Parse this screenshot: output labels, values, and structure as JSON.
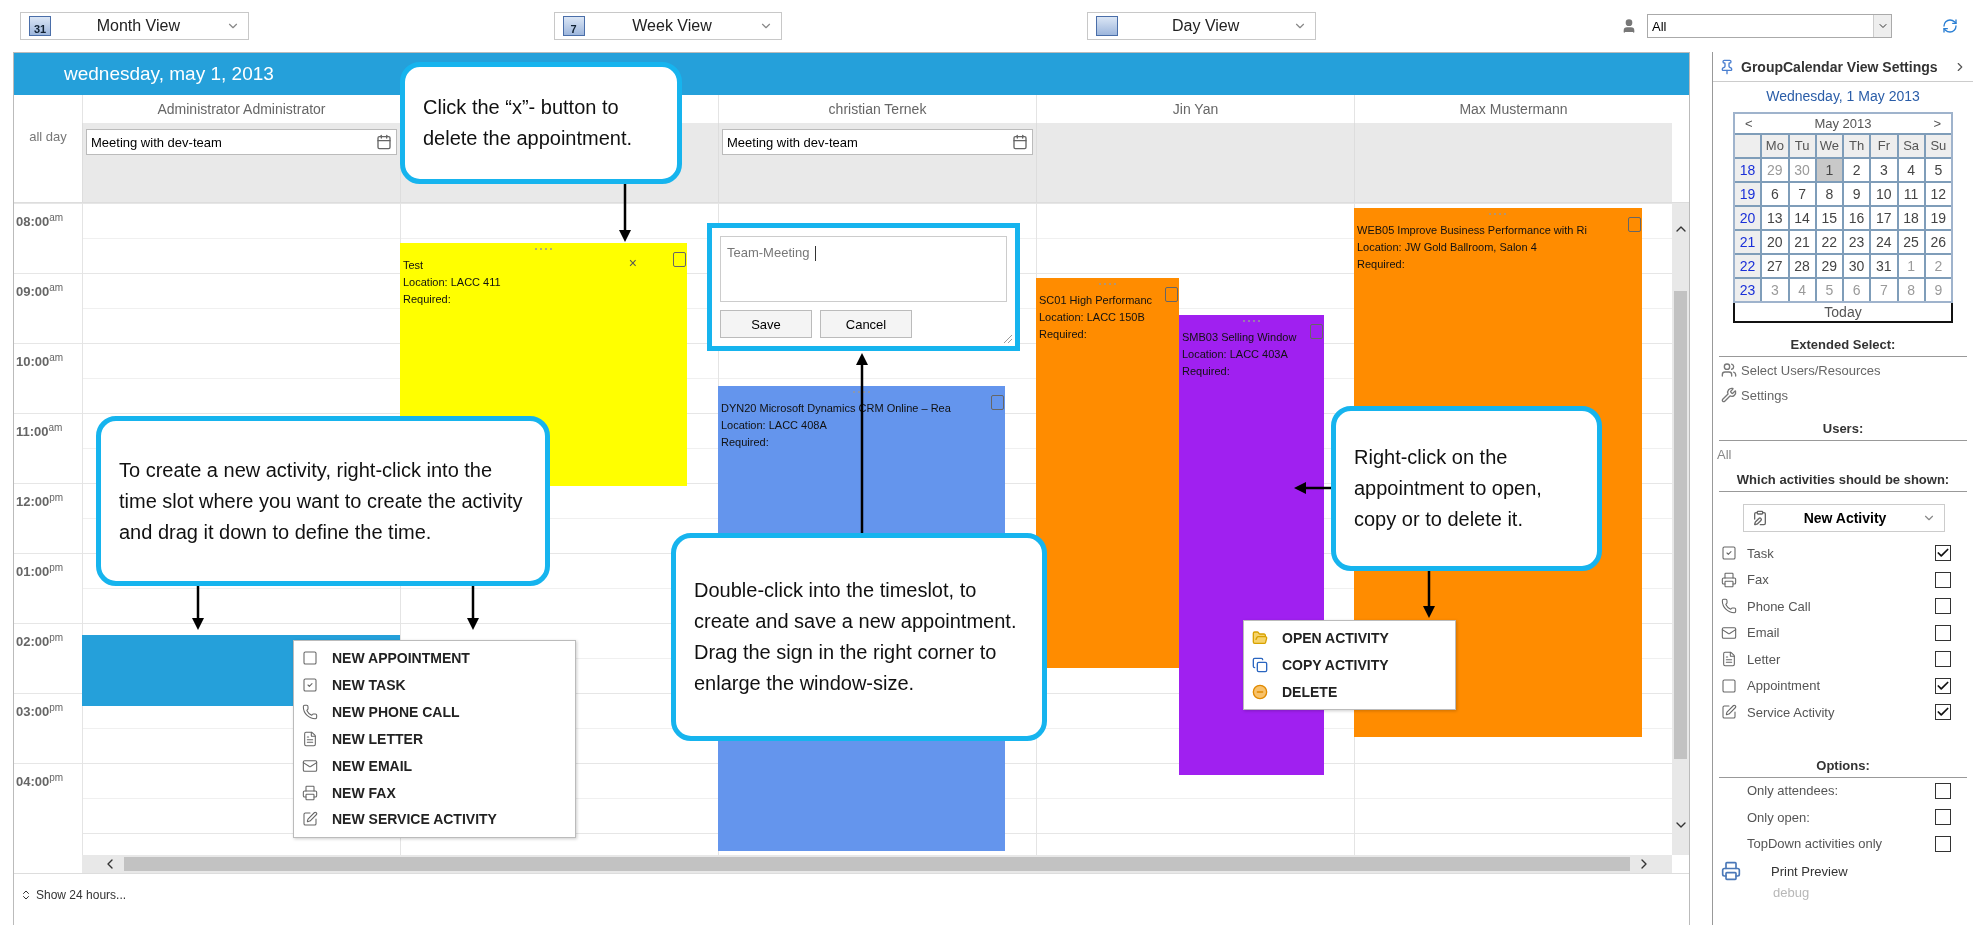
{
  "toolbar": {
    "views": [
      {
        "label": "Month View",
        "badge": "31"
      },
      {
        "label": "Week View",
        "badge": "7"
      },
      {
        "label": "Day View"
      }
    ],
    "user_filter": {
      "value": "All"
    }
  },
  "calendar": {
    "date_title": "wednesday, may 1, 2013",
    "all_day_label": "all day",
    "columns": [
      {
        "name": "Administrator Administrator",
        "all_day_event": "Meeting with dev-team",
        "slot_selected": true
      },
      {
        "slot_selected": false
      },
      {
        "name": "christian Ternek",
        "all_day_event": "Meeting with dev-team",
        "slot_selected": false
      },
      {
        "name": "Jin Yan",
        "slot_selected": false
      },
      {
        "name": "Max Mustermann",
        "slot_selected": false
      }
    ],
    "time_slots": [
      {
        "time": "08:00",
        "suffix": "am"
      },
      {
        "time": "09:00",
        "suffix": "am"
      },
      {
        "time": "10:00",
        "suffix": "am"
      },
      {
        "time": "11:00",
        "suffix": "am"
      },
      {
        "time": "12:00",
        "suffix": "pm"
      },
      {
        "time": "01:00",
        "suffix": "pm"
      },
      {
        "time": "02:00",
        "suffix": "pm"
      },
      {
        "time": "03:00",
        "suffix": "pm"
      },
      {
        "time": "04:00",
        "suffix": "pm"
      }
    ],
    "events": [
      {
        "title": "Test",
        "location": "Location: LACC 411",
        "required": "Required:",
        "color": "#ffff00",
        "delete_symbol": "×"
      },
      {
        "title": "DYN20 Microsoft Dynamics CRM Online – Rea",
        "location": "Location: LACC 408A",
        "required": "Required:",
        "color": "#6495ed"
      },
      {
        "title": "SC01 High Performanc",
        "location": "Location: LACC 150B",
        "required": "Required:",
        "color": "#ff8c00"
      },
      {
        "title": "SMB03 Selling Window",
        "location": "Location: LACC 403A",
        "required": "Required:",
        "color": "#a020f0"
      },
      {
        "title": "WEB05 Improve Business Performance with Ri",
        "location": "Location: JW Gold Ballroom, Salon 4",
        "required": "Required:",
        "color": "#ff8c00"
      }
    ],
    "editor": {
      "value": "Team-Meeting",
      "buttons": [
        "Save",
        "Cancel"
      ]
    },
    "context_menu": [
      {
        "label": "NEW APPOINTMENT",
        "kind": "appointment"
      },
      {
        "label": "NEW TASK",
        "kind": "task"
      },
      {
        "label": "NEW PHONE CALL",
        "kind": "phone"
      },
      {
        "label": "NEW LETTER",
        "kind": "letter"
      },
      {
        "label": "NEW EMAIL",
        "kind": "email"
      },
      {
        "label": "NEW FAX",
        "kind": "fax"
      },
      {
        "label": "NEW SERVICE ACTIVITY",
        "kind": "service"
      }
    ],
    "event_menu": [
      {
        "label": "OPEN ACTIVITY",
        "kind": "open"
      },
      {
        "label": "COPY ACTIVITY",
        "kind": "copy"
      },
      {
        "label": "DELETE",
        "kind": "delete"
      }
    ],
    "footer": "Show 24 hours..."
  },
  "callouts": [
    {
      "text": "Click the “x”- button to delete the appointment."
    },
    {
      "text": "To create a new activity, right-click into the time slot where you want to create the activity and drag it down to define the time."
    },
    {
      "text": "Double-click into the timeslot, to create and save a new appointment. Drag the sign in the right corner to enlarge the window-size."
    },
    {
      "text": "Right-click on the appointment to open, copy or to delete it."
    }
  ],
  "sidebar": {
    "title": "GroupCalendar View Settings",
    "date": "Wednesday, 1 May 2013",
    "mini_calendar": {
      "prev": "<",
      "month": "May 2013",
      "next": ">",
      "weekdays": [
        "Mo",
        "Tu",
        "We",
        "Th",
        "Fr",
        "Sa",
        "Su"
      ],
      "weeks": [
        {
          "number": "18",
          "days": [
            {
              "day": "29",
              "other_month": true,
              "selected": false
            },
            {
              "day": "30",
              "other_month": true,
              "selected": false
            },
            {
              "day": "1",
              "other_month": false,
              "selected": true
            },
            {
              "day": "2",
              "other_month": false,
              "selected": false
            },
            {
              "day": "3",
              "other_month": false,
              "selected": false
            },
            {
              "day": "4",
              "other_month": false,
              "selected": false
            },
            {
              "day": "5",
              "other_month": false,
              "selected": false
            }
          ]
        },
        {
          "number": "19",
          "days": [
            {
              "day": "6",
              "other_month": false,
              "selected": false
            },
            {
              "day": "7",
              "other_month": false,
              "selected": false
            },
            {
              "day": "8",
              "other_month": false,
              "selected": false
            },
            {
              "day": "9",
              "other_month": false,
              "selected": false
            },
            {
              "day": "10",
              "other_month": false,
              "selected": false
            },
            {
              "day": "11",
              "other_month": false,
              "selected": false
            },
            {
              "day": "12",
              "other_month": false,
              "selected": false
            }
          ]
        },
        {
          "number": "20",
          "days": [
            {
              "day": "13",
              "other_month": false,
              "selected": false
            },
            {
              "day": "14",
              "other_month": false,
              "selected": false
            },
            {
              "day": "15",
              "other_month": false,
              "selected": false
            },
            {
              "day": "16",
              "other_month": false,
              "selected": false
            },
            {
              "day": "17",
              "other_month": false,
              "selected": false
            },
            {
              "day": "18",
              "other_month": false,
              "selected": false
            },
            {
              "day": "19",
              "other_month": false,
              "selected": false
            }
          ]
        },
        {
          "number": "21",
          "days": [
            {
              "day": "20",
              "other_month": false,
              "selected": false
            },
            {
              "day": "21",
              "other_month": false,
              "selected": false
            },
            {
              "day": "22",
              "other_month": false,
              "selected": false
            },
            {
              "day": "23",
              "other_month": false,
              "selected": false
            },
            {
              "day": "24",
              "other_month": false,
              "selected": false
            },
            {
              "day": "25",
              "other_month": false,
              "selected": false
            },
            {
              "day": "26",
              "other_month": false,
              "selected": false
            }
          ]
        },
        {
          "number": "22",
          "days": [
            {
              "day": "27",
              "other_month": false,
              "selected": false
            },
            {
              "day": "28",
              "other_month": false,
              "selected": false
            },
            {
              "day": "29",
              "other_month": false,
              "selected": false
            },
            {
              "day": "30",
              "other_month": false,
              "selected": false
            },
            {
              "day": "31",
              "other_month": false,
              "selected": false
            },
            {
              "day": "1",
              "other_month": true,
              "selected": false
            },
            {
              "day": "2",
              "other_month": true,
              "selected": false
            }
          ]
        },
        {
          "number": "23",
          "days": [
            {
              "day": "3",
              "other_month": true,
              "selected": false
            },
            {
              "day": "4",
              "other_month": true,
              "selected": false
            },
            {
              "day": "5",
              "other_month": true,
              "selected": false
            },
            {
              "day": "6",
              "other_month": true,
              "selected": false
            },
            {
              "day": "7",
              "other_month": true,
              "selected": false
            },
            {
              "day": "8",
              "other_month": true,
              "selected": false
            },
            {
              "day": "9",
              "other_month": true,
              "selected": false
            }
          ]
        }
      ],
      "today": "Today"
    },
    "extended_select_title": "Extended Select:",
    "links": [
      {
        "label": "Select Users/Resources",
        "kind": "users"
      },
      {
        "label": "Settings",
        "kind": "settings"
      }
    ],
    "users_title": "Users:",
    "users_value": "All",
    "activities_title": "Which activities should be shown:",
    "new_activity": "New Activity",
    "activities": [
      {
        "label": "Task",
        "kind": "task",
        "checked": true
      },
      {
        "label": "Fax",
        "kind": "fax",
        "checked": false
      },
      {
        "label": "Phone Call",
        "kind": "phone",
        "checked": false
      },
      {
        "label": "Email",
        "kind": "email",
        "checked": false
      },
      {
        "label": "Letter",
        "kind": "letter",
        "checked": false
      },
      {
        "label": "Appointment",
        "kind": "appointment",
        "checked": true
      },
      {
        "label": "Service Activity",
        "kind": "service",
        "checked": true
      }
    ],
    "options_title": "Options:",
    "options": [
      {
        "label": "Only attendees:",
        "checked": false
      },
      {
        "label": "Only open:",
        "checked": false
      },
      {
        "label": "TopDown activities only",
        "checked": false
      }
    ],
    "print_preview": "Print Preview",
    "debug": "debug"
  }
}
